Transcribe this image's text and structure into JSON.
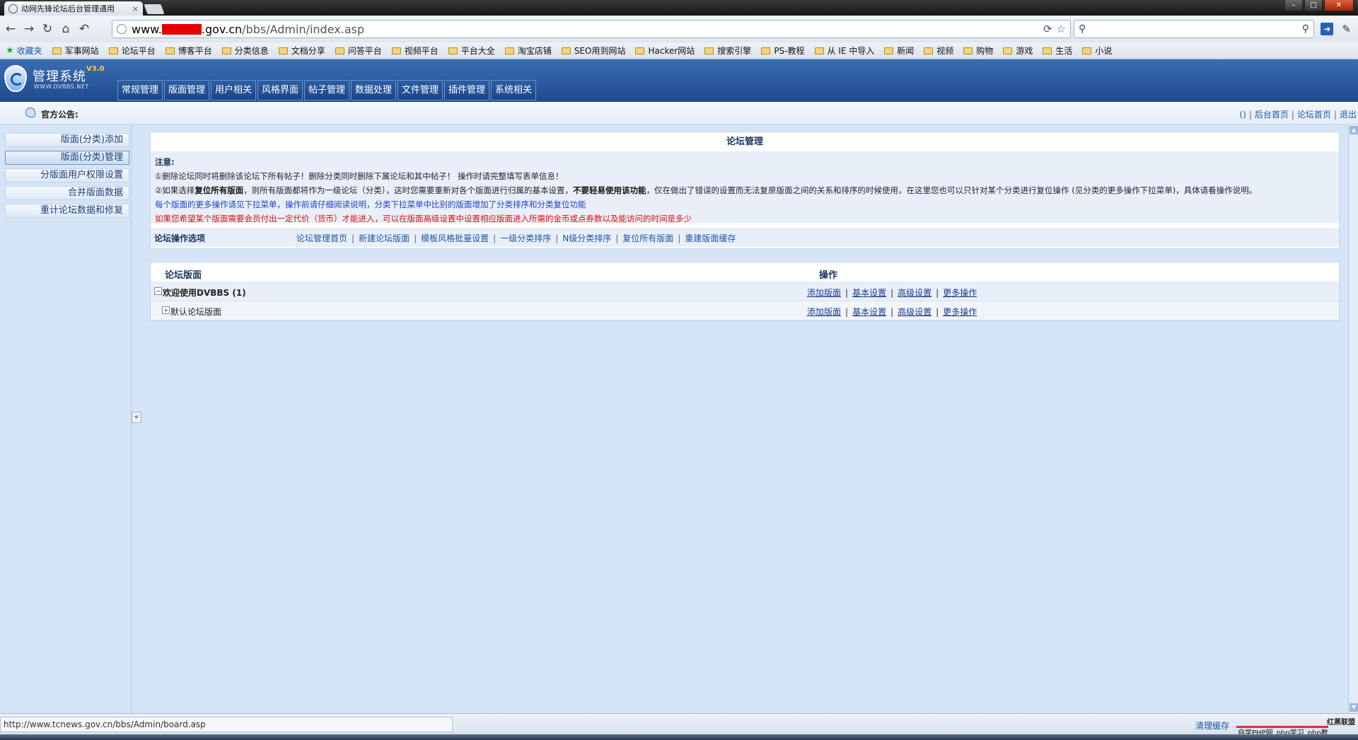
{
  "browser": {
    "tab_title": "动网先锋论坛后台管理通用",
    "tab_close": "×",
    "url_host_prefix": "www.",
    "url_host_suffix": ".gov.cn",
    "url_path": "/bbs/Admin/index.asp",
    "window_controls": [
      "–",
      "□",
      "✕"
    ],
    "bookmarks_favorites": "收藏夹",
    "bookmarks": [
      "军事网站",
      "论坛平台",
      "博客平台",
      "分类信息",
      "文档分享",
      "问答平台",
      "视频平台",
      "平台大全",
      "淘宝店铺",
      "SEO用到网站",
      "Hacker网站",
      "搜索引擎",
      "PS-教程",
      "从 IE 中导入",
      "新闻",
      "视频",
      "购物",
      "游戏",
      "生活",
      "小说"
    ]
  },
  "header": {
    "logo_title": "管理系统",
    "logo_version": "V3.0",
    "logo_url": "WWW.DVBBS.NET",
    "nav": [
      "常规管理",
      "版面管理",
      "用户相关",
      "风格界面",
      "帖子管理",
      "数据处理",
      "文件管理",
      "插件管理",
      "系统相关"
    ]
  },
  "notice": {
    "label": "官方公告:",
    "links": [
      "()",
      "后台首页",
      "论坛首页",
      "退出"
    ]
  },
  "sidebar": {
    "items": [
      "版面(分类)添加",
      "版面(分类)管理",
      "分版面用户权限设置",
      "合并版面数据",
      "重计论坛数据和修复"
    ],
    "collapse": "«"
  },
  "panel1": {
    "title": "论坛管理",
    "note_label": "注意:",
    "note1": "①删除论坛同时将删除该论坛下所有帖子！删除分类同时删除下属论坛和其中帖子！ 操作时请完整填写表单信息！",
    "note2_pre": "②如果选择",
    "note2_bold1": "复位所有版面",
    "note2_mid": "，则所有版面都将作为一级论坛（分类），这时您需要重新对各个版面进行归属的基本设置，",
    "note2_bold2": "不要轻易使用该功能",
    "note2_post": "，仅在做出了错误的设置而无法复原版面之间的关系和排序的时候使用，在这里您也可以只针对某个分类进行复位操作 (见分类的更多操作下拉菜单)，具体请看操作说明。",
    "note3": "每个版面的更多操作请见下拉菜单，操作前请仔细阅读说明，分类下拉菜单中比别的版面增加了分类排序和分类复位功能",
    "note4": "如果您希望某个版面需要会员付出一定代价（货币）才能进入，可以在版面高级设置中设置相应版面进入所需的金币或点券数以及能访问的时间是多少",
    "ops_label": "论坛操作选项",
    "ops_links": [
      "论坛管理首页",
      "新建论坛版面",
      "模板风格批量设置",
      "一级分类排序",
      "N级分类排序",
      "复位所有版面",
      "重建版面缓存"
    ]
  },
  "panel2": {
    "col_board": "论坛版面",
    "col_ops": "操作",
    "rows": [
      {
        "name": "欢迎使用DVBBS (1)",
        "expand": "−"
      },
      {
        "name": "默认论坛版面",
        "expand": "+"
      }
    ],
    "actions": [
      "添加版面",
      "基本设置",
      "高级设置",
      "更多操作"
    ]
  },
  "statusbar": {
    "url": "http://www.tcnews.gov.cn/bbs/Admin/board.asp",
    "right_text": "清理缓存",
    "watermark_tag": "红黑联盟",
    "watermark_line": "自学PHP网_php学习_php教"
  },
  "colors": {
    "header_blue": "#1e4a8a",
    "link_blue": "#1d57a8",
    "alert_red": "#e01010",
    "note_blue": "#1e40c8",
    "page_bg": "#d6e4f7"
  }
}
